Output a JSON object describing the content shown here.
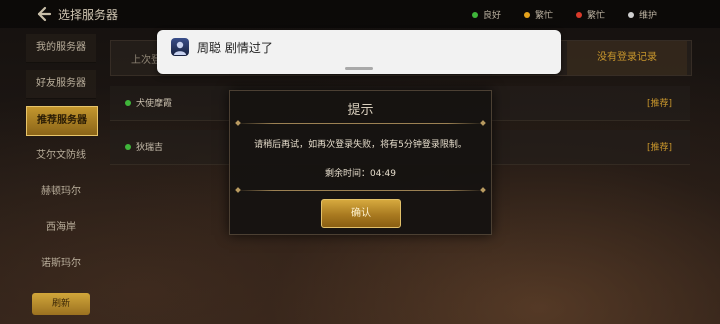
{
  "header": {
    "title": "选择服务器"
  },
  "status_legend": [
    {
      "label": "良好",
      "color": "#3fb53a"
    },
    {
      "label": "繁忙",
      "color": "#e5a21b"
    },
    {
      "label": "繁忙",
      "color": "#d93a2a"
    },
    {
      "label": "维护",
      "color": "#cfcfcf"
    }
  ],
  "sidebar": {
    "items": [
      {
        "label": "我的服务器"
      },
      {
        "label": "好友服务器"
      },
      {
        "label": "推荐服务器"
      },
      {
        "label": "艾尔文防线"
      },
      {
        "label": "赫顿玛尔"
      },
      {
        "label": "西海岸"
      },
      {
        "label": "诺斯玛尔"
      }
    ],
    "button_label": "刷新"
  },
  "main": {
    "last_login_label": "上次登录",
    "no_record_label": "没有登录记录",
    "servers": [
      {
        "name": "犬使摩霞",
        "tag": "[推荐]"
      },
      {
        "name": "狄瑞吉",
        "tag": "[推荐]"
      }
    ]
  },
  "notification": {
    "text": "周聪 剧情过了"
  },
  "dialog": {
    "title": "提示",
    "message": "请稍后再试，如再次登录失败，将有5分钟登录限制。",
    "timer": "剩余时间：04:49",
    "confirm_label": "确认"
  }
}
